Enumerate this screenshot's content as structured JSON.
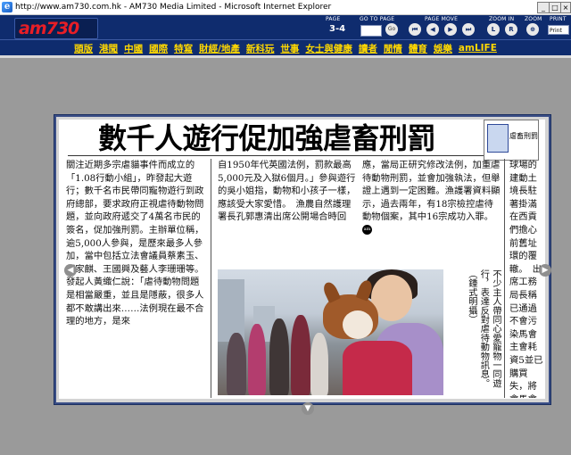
{
  "window": {
    "title": "http://www.am730.com.hk - AM730 Media Limited - Microsoft Internet Explorer"
  },
  "header": {
    "logo": "am730",
    "labels": {
      "page": "PAGE",
      "goto": "GO TO PAGE",
      "move": "PAGE MOVE",
      "zoom_in": "ZOOM IN",
      "zoom": "ZOOM",
      "print": "PRINT"
    },
    "page_value": "3-4",
    "go_label": "Go",
    "zoom_in_buttons": [
      "L",
      "R"
    ],
    "print_option": "Print"
  },
  "sections": [
    "頭版",
    "港聞",
    "中國",
    "國際",
    "特寫",
    "財經/地產",
    "新科玩",
    "世事",
    "女士與健康",
    "讀者",
    "閒情",
    "體育",
    "娛樂",
    "amLIFE"
  ],
  "article": {
    "headline": "數千人遊行促加強虐畜刑罰",
    "thumbnail_caption": "虐畜刑罰",
    "col1": "關注近期多宗虐貓事件而成立的「1.08行動小組」，昨發起大遊行；數千名市民帶同寵物遊行到政府總部，要求政府正視虐待動物問題，並向政府遞交了4萬名市民的簽名，促加強刑罰。主辦單位稱，逾5,000人參與，是歷來最多人參加，當中包括立法會議員蔡素玉、郭家麒、王國興及藝人李珊珊等。　發起人黃織仁說：「虐待動物問題是相當嚴重，並且是隱蔽，很多人都不敢講出來……法例現在最不合理的地方，是來",
    "col2": "自1950年代英國法例，罰款最高5,000元及入獄6個月。」參與遊行的吳小姐指，動物和小孩子一樣，應該受大家愛惜。　漁農自然護理署長孔郭惠清出席公開場合時回",
    "col3": "應，當局正研究修改法例，加重虐待動物刑罰，並會加強執法，但舉證上遇到一定困難。漁護署資料顯示，過去兩年，有18宗檢控虐待動物個案，其中16宗成功入罪。",
    "col3_mark": "am",
    "col4": "球場的建動土境長駐著掛滿在西貢們擔心前舊址環的覆轍。　出席工務局長稱已通過不會污染馬會主會耗資5並已購買失，將會馬會不會",
    "caption": "不少主人帶同心愛寵物一同遊行，表達反對虐待動物訊息。（鍾式明攝）"
  },
  "colors": {
    "header_bg": "#0f2c6e",
    "section_text": "#ffd800",
    "logo_red": "#e81e26",
    "page_bg": "#9a9a9a"
  }
}
